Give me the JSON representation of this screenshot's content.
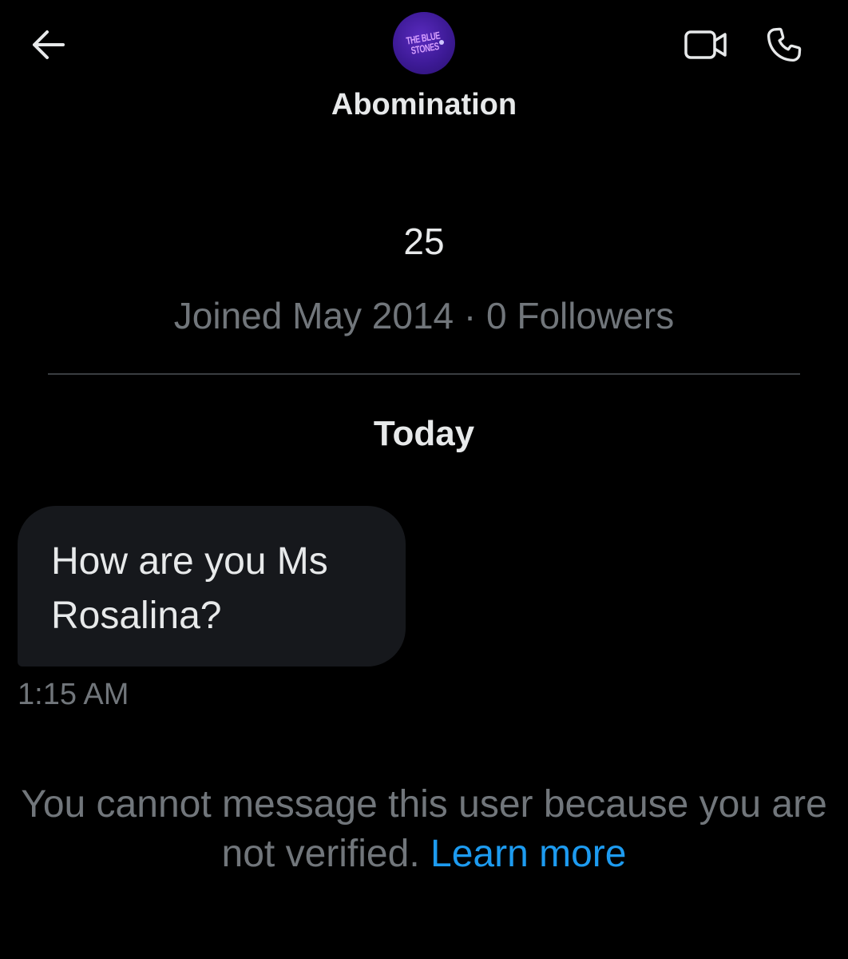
{
  "header": {
    "back_icon": "arrow-left-icon",
    "avatar_text": "THE BLUE STONES",
    "contact_name": "Abomination",
    "video_icon": "video-call-icon",
    "call_icon": "phone-icon"
  },
  "profile": {
    "age": "25",
    "meta": "Joined May 2014 · 0 Followers"
  },
  "conversation": {
    "date_label": "Today",
    "messages": [
      {
        "text": "How are you Ms Rosalina?",
        "time": "1:15 AM"
      }
    ]
  },
  "notice": {
    "text": "You cannot message this user because you are not verified.",
    "link": "Learn more"
  },
  "colors": {
    "background": "#000000",
    "primary_text": "#e7e9ea",
    "secondary_text": "#71767b",
    "bubble": "#16181c",
    "link": "#1d9bf0",
    "avatar": "#3d1a96"
  }
}
